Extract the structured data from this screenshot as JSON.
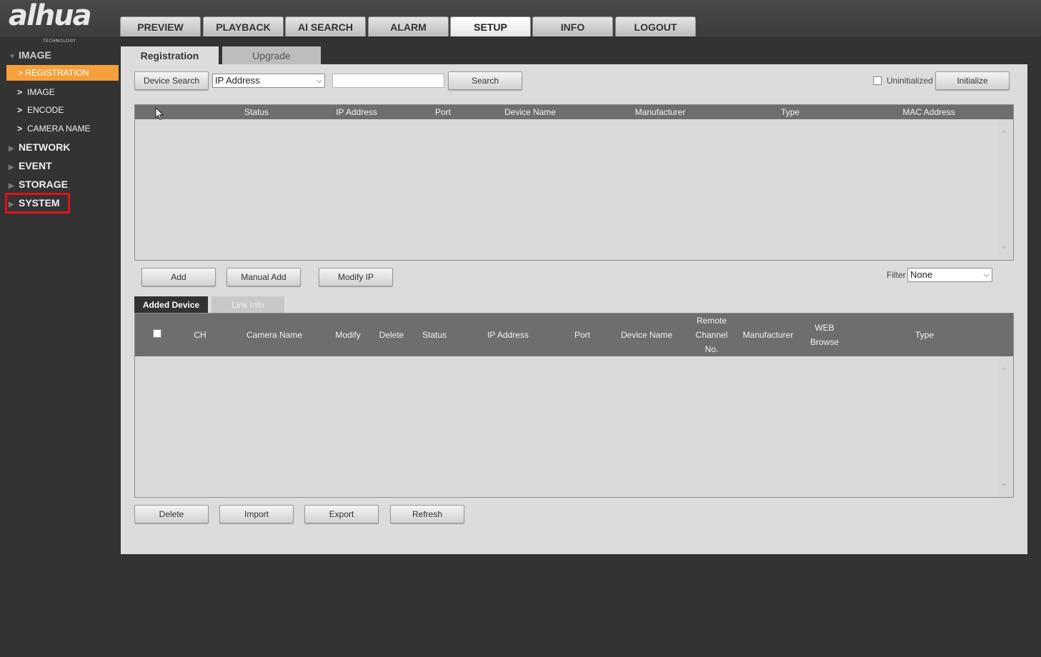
{
  "brand": {
    "logo_text": "alhua",
    "logo_sub": "TECHNOLOGY"
  },
  "top_nav": {
    "items": [
      {
        "label": "PREVIEW"
      },
      {
        "label": "PLAYBACK"
      },
      {
        "label": "AI SEARCH"
      },
      {
        "label": "ALARM"
      },
      {
        "label": "SETUP"
      },
      {
        "label": "INFO"
      },
      {
        "label": "LOGOUT"
      }
    ],
    "active": "SETUP"
  },
  "sidebar": {
    "groups": [
      {
        "label": "IMAGE",
        "expanded": true
      },
      {
        "label": "NETWORK"
      },
      {
        "label": "EVENT"
      },
      {
        "label": "STORAGE"
      },
      {
        "label": "SYSTEM",
        "highlighted": true
      }
    ],
    "subitems": [
      {
        "label": "REGISTRATION",
        "selected": true
      },
      {
        "label": "IMAGE"
      },
      {
        "label": "ENCODE"
      },
      {
        "label": "CAMERA NAME"
      }
    ],
    "expand_icon": "triangle-down-icon",
    "collapsed_icon": "triangle-right-icon",
    "sub_icon": "chevron-right-icon",
    "highlight_color": "#e0121b",
    "selected_color": "#f5a03a"
  },
  "tabs": {
    "registration": "Registration",
    "upgrade": "Upgrade"
  },
  "search_bar": {
    "device_search": "Device Search",
    "search_type": "IP Address",
    "search_value": "",
    "search_button": "Search",
    "uninitialized_label": "Uninitialized",
    "uninitialized_checked": false,
    "initialize_button": "Initialize"
  },
  "search_table": {
    "columns": [
      "Status",
      "IP Address",
      "Port",
      "Device Name",
      "Manufacturer",
      "Type",
      "MAC Address"
    ],
    "rows": []
  },
  "actions": {
    "add": "Add",
    "manual_add": "Manual Add",
    "modify_ip": "Modify IP",
    "filter_label": "Filter",
    "filter_value": "None"
  },
  "subtabs": {
    "added_device": "Added Device",
    "link_info": "Link Info"
  },
  "added_table": {
    "columns": {
      "ch": "CH",
      "camera_name": "Camera Name",
      "modify": "Modify",
      "delete": "Delete",
      "status": "Status",
      "ip_address": "IP Address",
      "port": "Port",
      "device_name": "Device Name",
      "remote_channel_1": "Remote",
      "remote_channel_2": "Channel",
      "remote_channel_3": "No.",
      "manufacturer": "Manufacturer",
      "web_browse_1": "WEB",
      "web_browse_2": "Browse",
      "type": "Type"
    },
    "select_all_checked": false,
    "rows": []
  },
  "bottom_buttons": {
    "delete": "Delete",
    "import": "Import",
    "export": "Export",
    "refresh": "Refresh"
  },
  "icons": {
    "scroll_up": "chevron-up-icon",
    "scroll_down": "chevron-down-icon",
    "dropdown": "chevron-down-icon",
    "cursor": "mouse-pointer-icon"
  }
}
